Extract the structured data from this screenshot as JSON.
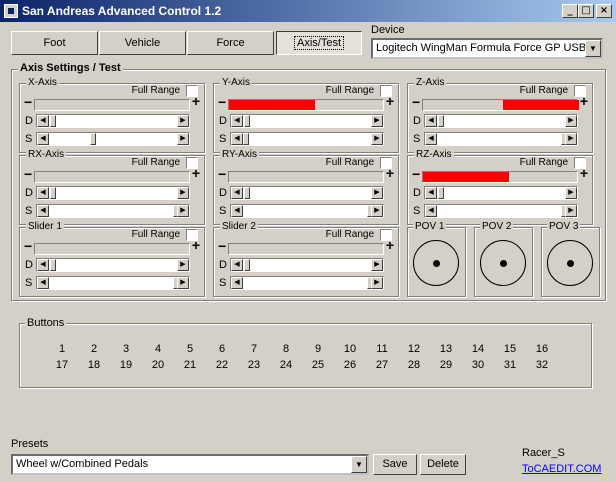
{
  "window": {
    "title": "San Andreas Advanced Control 1.2",
    "minimize": "_",
    "maximize": "□",
    "close": "×"
  },
  "tabs": [
    {
      "label": "Foot"
    },
    {
      "label": "Vehicle"
    },
    {
      "label": "Force"
    },
    {
      "label": "Axis/Test",
      "active": true
    }
  ],
  "device": {
    "label": "Device",
    "selected": "Logitech WingMan Formula Force GP USB"
  },
  "axis_settings": {
    "title": "Axis Settings / Test",
    "full_range_label": "Full Range",
    "deadzone_label": "D",
    "saturation_label": "S",
    "minus": "−",
    "plus": "+",
    "axes": [
      {
        "name": "X-Axis",
        "fill_start": 0,
        "fill_end": 0,
        "s_thumb": 0.33
      },
      {
        "name": "Y-Axis",
        "fill_start": 0,
        "fill_end": 0.55,
        "s_thumb": 0
      },
      {
        "name": "Z-Axis",
        "fill_start": 0.51,
        "fill_end": 1,
        "s_thumb": 1
      },
      {
        "name": "RX-Axis",
        "fill_start": 0,
        "fill_end": 0,
        "s_thumb": 1
      },
      {
        "name": "RY-Axis",
        "fill_start": 0,
        "fill_end": 0,
        "s_thumb": 1
      },
      {
        "name": "RZ-Axis",
        "fill_start": 0,
        "fill_end": 0.55,
        "s_thumb": 1
      },
      {
        "name": "Slider 1",
        "fill_start": 0,
        "fill_end": 0,
        "s_thumb": 1
      },
      {
        "name": "Slider 2",
        "fill_start": 0,
        "fill_end": 0,
        "s_thumb": 1
      }
    ],
    "povs": [
      {
        "name": "POV 1"
      },
      {
        "name": "POV 2"
      },
      {
        "name": "POV 3"
      }
    ],
    "fill_color": "#ff0000"
  },
  "buttons": {
    "title": "Buttons",
    "row1": [
      "1",
      "2",
      "3",
      "4",
      "5",
      "6",
      "7",
      "8",
      "9",
      "10",
      "11",
      "12",
      "13",
      "14",
      "15",
      "16"
    ],
    "row2": [
      "17",
      "18",
      "19",
      "20",
      "21",
      "22",
      "23",
      "24",
      "25",
      "26",
      "27",
      "28",
      "29",
      "30",
      "31",
      "32"
    ]
  },
  "presets": {
    "label": "Presets",
    "selected": "Wheel w/Combined Pedals",
    "save_label": "Save",
    "delete_label": "Delete"
  },
  "credits": {
    "author": "Racer_S",
    "link": "ToCAEDIT.COM"
  }
}
